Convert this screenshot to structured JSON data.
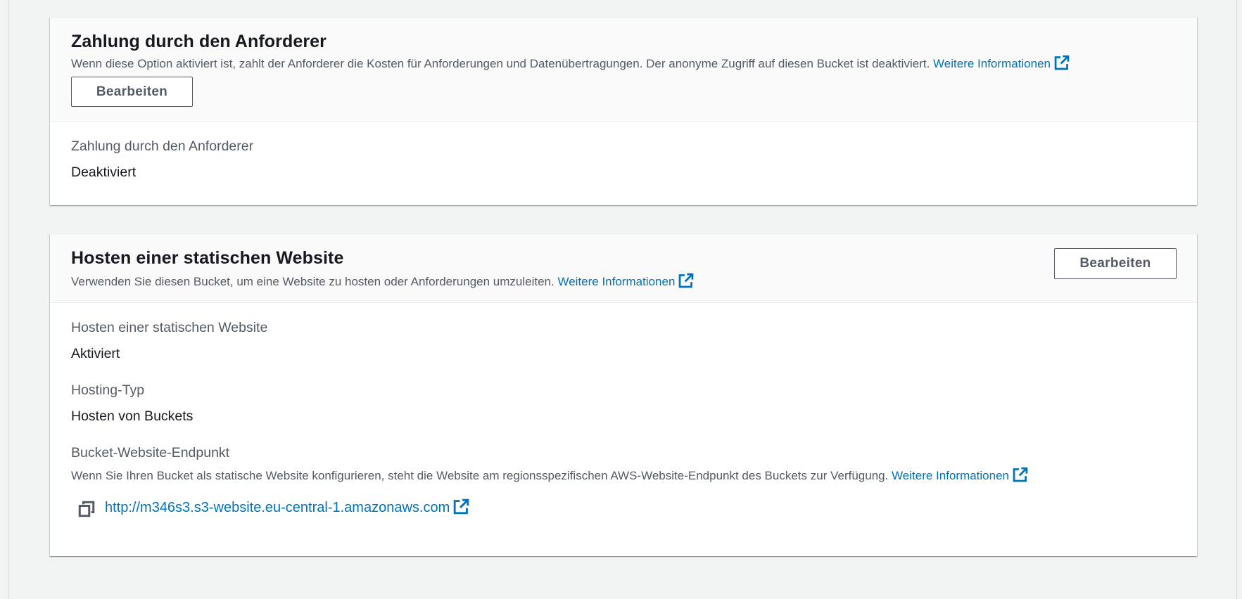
{
  "requester_pays": {
    "title": "Zahlung durch den Anforderer",
    "description": "Wenn diese Option aktiviert ist, zahlt der Anforderer die Kosten für Anforderungen und Datenübertragungen. Der anonyme Zugriff auf diesen Bucket ist deaktiviert.",
    "learn_more": "Weitere Informationen",
    "edit_label": "Bearbeiten",
    "field_label": "Zahlung durch den Anforderer",
    "field_value": "Deaktiviert"
  },
  "static_website": {
    "title": "Hosten einer statischen Website",
    "description": "Verwenden Sie diesen Bucket, um eine Website zu hosten oder Anforderungen umzuleiten.",
    "learn_more": "Weitere Informationen",
    "edit_label": "Bearbeiten",
    "hosting_label": "Hosten einer statischen Website",
    "hosting_value": "Aktiviert",
    "type_label": "Hosting-Typ",
    "type_value": "Hosten von Buckets",
    "endpoint_label": "Bucket-Website-Endpunkt",
    "endpoint_description": "Wenn Sie Ihren Bucket als statische Website konfigurieren, steht die Website am regionsspezifischen AWS-Website-Endpunkt des Buckets zur Verfügung.",
    "endpoint_learn_more": "Weitere Informationen",
    "endpoint_url": "http://m346s3.s3-website.eu-central-1.amazonaws.com"
  },
  "icons": {
    "external": "external-link-icon",
    "copy": "copy-icon"
  },
  "colors": {
    "link": "#0073bb",
    "text": "#16191f",
    "secondary": "#545b64",
    "background": "#f2f3f3"
  }
}
